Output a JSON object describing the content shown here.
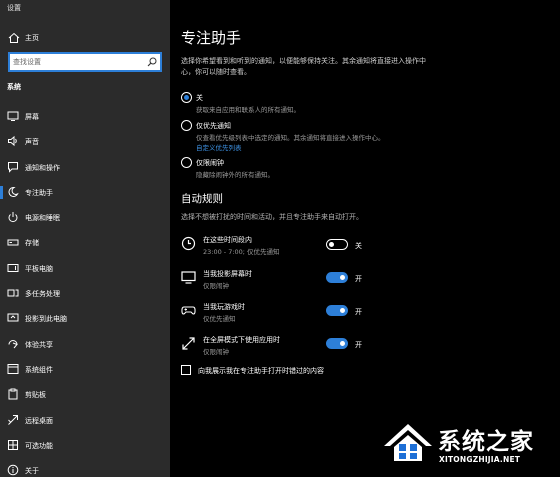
{
  "window": {
    "title": "设置"
  },
  "sidebar": {
    "home_label": "主页",
    "search_placeholder": "查找设置",
    "section_label": "系统",
    "items": [
      {
        "label": "屏幕",
        "icon": "monitor-icon"
      },
      {
        "label": "声音",
        "icon": "speaker-icon"
      },
      {
        "label": "通知和操作",
        "icon": "notification-icon"
      },
      {
        "label": "专注助手",
        "icon": "moon-icon",
        "active": true
      },
      {
        "label": "电源和睡眠",
        "icon": "power-icon"
      },
      {
        "label": "存储",
        "icon": "storage-icon"
      },
      {
        "label": "平板电脑",
        "icon": "tablet-icon"
      },
      {
        "label": "多任务处理",
        "icon": "multitask-icon"
      },
      {
        "label": "投影到此电脑",
        "icon": "project-icon"
      },
      {
        "label": "体验共享",
        "icon": "share-icon"
      },
      {
        "label": "系统组件",
        "icon": "components-icon"
      },
      {
        "label": "剪贴板",
        "icon": "clipboard-icon"
      },
      {
        "label": "远程桌面",
        "icon": "remote-desktop-icon"
      },
      {
        "label": "可选功能",
        "icon": "optional-features-icon"
      },
      {
        "label": "关于",
        "icon": "info-icon"
      }
    ]
  },
  "main": {
    "title": "专注助手",
    "intro": "选择你希望看到和听到的通知，以便能够保持关注。其余通知将直接进入操作中心，你可以随时查看。",
    "options": [
      {
        "title": "关",
        "desc": "获取来自应用和联系人的所有通知。",
        "selected": true
      },
      {
        "title": "仅优先通知",
        "desc": "仅查看优先级列表中选定的通知。其余通知将直接进入操作中心。",
        "link": "自定义优先列表",
        "selected": false
      },
      {
        "title": "仅限闹钟",
        "desc": "隐藏除闹钟外的所有通知。",
        "selected": false
      }
    ],
    "auto_rules_title": "自动规则",
    "auto_rules_desc": "选择不想被打扰的时间和活动，并且专注助手来自动打开。",
    "rules": [
      {
        "title": "在这些时间段内",
        "desc": "23:00 - 7:00; 仅优先通知",
        "on": false,
        "state_label": "关",
        "icon": "clock-icon"
      },
      {
        "title": "当我投影屏幕时",
        "desc": "仅限闹钟",
        "on": true,
        "state_label": "开",
        "icon": "display-icon"
      },
      {
        "title": "当我玩游戏时",
        "desc": "仅优先通知",
        "on": true,
        "state_label": "开",
        "icon": "gamepad-icon"
      },
      {
        "title": "在全屏模式下使用应用时",
        "desc": "仅限闹钟",
        "on": true,
        "state_label": "开",
        "icon": "fullscreen-icon"
      }
    ],
    "summary_checkbox": {
      "label": "向我展示我在专注助手打开时错过的内容",
      "checked": false
    }
  },
  "watermark": {
    "text": "系统之家",
    "subtext": "XITONGZHIJIA.NET"
  },
  "colors": {
    "accent": "#2d7fd8",
    "sidebar_bg": "#2b2b2b",
    "main_bg": "#000000",
    "link": "#3f95e8"
  }
}
